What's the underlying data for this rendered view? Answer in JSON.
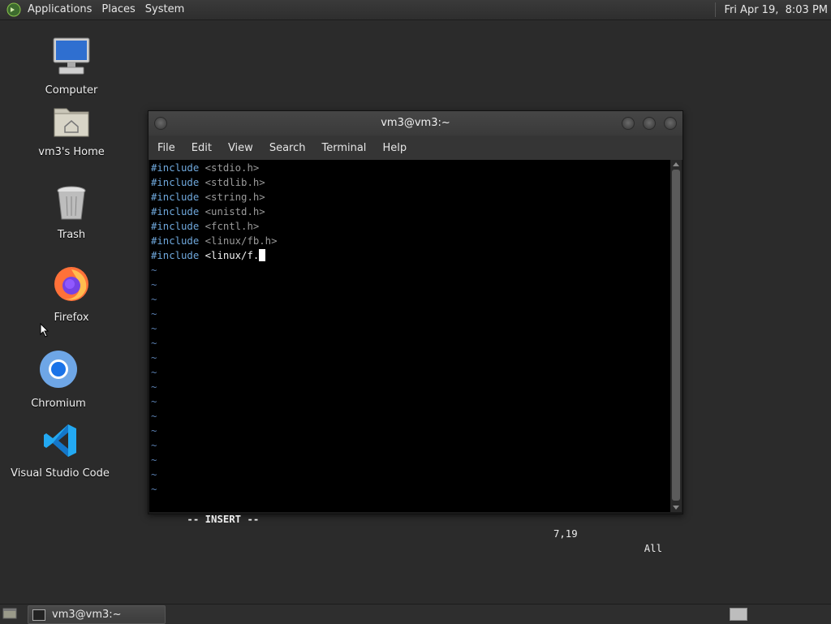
{
  "top_panel": {
    "menus": [
      "Applications",
      "Places",
      "System"
    ],
    "clock": "Fri Apr 19,  8:03 PM"
  },
  "desktop_icons": [
    {
      "label": "Computer",
      "icon": "computer-icon"
    },
    {
      "label": "vm3's Home",
      "icon": "home-folder-icon"
    },
    {
      "label": "Trash",
      "icon": "trash-icon"
    },
    {
      "label": "Firefox",
      "icon": "firefox-icon"
    },
    {
      "label": "Chromium",
      "icon": "chromium-icon"
    },
    {
      "label": "Visual Studio Code",
      "icon": "vscode-icon"
    }
  ],
  "terminal": {
    "title": "vm3@vm3:~",
    "menus": [
      "File",
      "Edit",
      "View",
      "Search",
      "Terminal",
      "Help"
    ],
    "lines": [
      {
        "keyword": "#include",
        "rest": " <stdio.h>"
      },
      {
        "keyword": "#include",
        "rest": " <stdlib.h>"
      },
      {
        "keyword": "#include",
        "rest": " <string.h>"
      },
      {
        "keyword": "#include",
        "rest": " <unistd.h>"
      },
      {
        "keyword": "#include",
        "rest": " <fcntl.h>"
      },
      {
        "keyword": "#include",
        "rest": " <linux/fb.h>"
      },
      {
        "keyword": "#include",
        "rest": " <linux/f."
      }
    ],
    "tilde_char": "~",
    "status": {
      "mode": "-- INSERT --",
      "position": "7,19",
      "scope": "All"
    }
  },
  "taskbar": {
    "window_button": "vm3@vm3:~"
  },
  "colors": {
    "keyword": "#6fa8dc",
    "include_path": "#9a9a9a",
    "tilde": "#5a7fb0",
    "desktop_bg": "#2b2b2b"
  }
}
